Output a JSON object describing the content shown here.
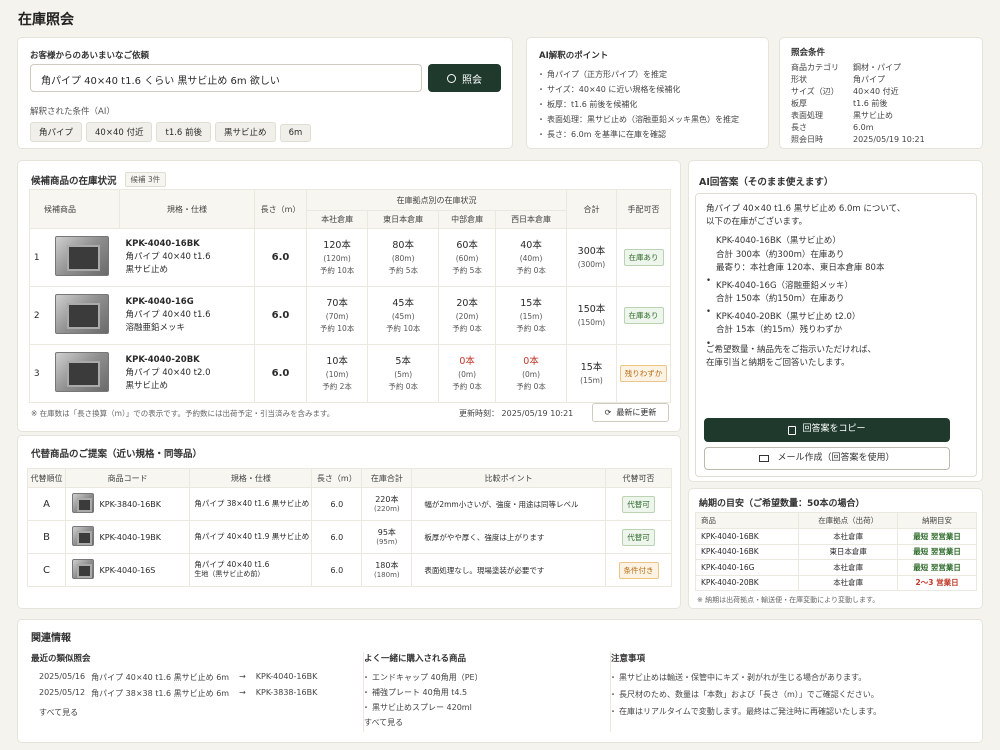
{
  "page": {
    "title": "在庫照会"
  },
  "query": {
    "label": "お客様からのあいまいなご依頼",
    "value": "角パイプ 40×40 t1.6 くらい 黒サビ止め 6m 欲しい",
    "button": "照会",
    "parsed_label": "解釈された条件（AI）",
    "chips": [
      "角パイプ",
      "40×40 付近",
      "t1.6 前後",
      "黒サビ止め",
      "6m"
    ]
  },
  "ai_points": {
    "title": "AI解釈のポイント",
    "items": [
      "角パイプ（正方形パイプ）を推定",
      "サイズ：40×40 に近い規格を候補化",
      "板厚：t1.6 前後を候補化",
      "表面処理：黒サビ止め（溶融亜鉛メッキ黒色）を推定",
      "長さ：6.0m を基準に在庫を確認"
    ]
  },
  "conditions": {
    "title": "照会条件",
    "rows": [
      [
        "商品カテゴリ",
        "鋼材・パイプ"
      ],
      [
        "形状",
        "角パイプ"
      ],
      [
        "サイズ（辺）",
        "40×40 付近"
      ],
      [
        "板厚",
        "t1.6 前後"
      ],
      [
        "表面処理",
        "黒サビ止め"
      ],
      [
        "長さ",
        "6.0m"
      ],
      [
        "照会日時",
        "2025/05/19 10:21"
      ]
    ]
  },
  "stock": {
    "title": "候補商品の在庫状況",
    "count": "候補 3件",
    "headers": {
      "item": "候補商品",
      "spec": "規格・仕様",
      "length": "長さ（m）",
      "by_loc": "在庫拠点別の在庫状況",
      "locs": [
        "本社倉庫",
        "東日本倉庫",
        "中部倉庫",
        "西日本倉庫"
      ],
      "total": "合計",
      "avail": "手配可否"
    },
    "rows": [
      {
        "no": "1",
        "code": "KPK-4040-16BK",
        "spec1": "角パイプ 40×40 t1.6",
        "spec2": "黒サビ止め",
        "length": "6.0",
        "locs": [
          [
            "120本",
            "(120m)",
            "予約 10本"
          ],
          [
            "80本",
            "(80m)",
            "予約 5本"
          ],
          [
            "60本",
            "(60m)",
            "予約 5本"
          ],
          [
            "40本",
            "(40m)",
            "予約 0本"
          ]
        ],
        "total": "300本",
        "total_m": "(300m)",
        "avail": "在庫あり"
      },
      {
        "no": "2",
        "code": "KPK-4040-16G",
        "spec1": "角パイプ 40×40 t1.6",
        "spec2": "溶融亜鉛メッキ",
        "length": "6.0",
        "locs": [
          [
            "70本",
            "(70m)",
            "予約 10本"
          ],
          [
            "45本",
            "(45m)",
            "予約 10本"
          ],
          [
            "20本",
            "(20m)",
            "予約 0本"
          ],
          [
            "15本",
            "(15m)",
            "予約 0本"
          ]
        ],
        "total": "150本",
        "total_m": "(150m)",
        "avail": "在庫あり"
      },
      {
        "no": "3",
        "code": "KPK-4040-20BK",
        "spec1": "角パイプ 40×40 t2.0",
        "spec2": "黒サビ止め",
        "length": "6.0",
        "locs": [
          [
            "10本",
            "(10m)",
            "予約 2本"
          ],
          [
            "5本",
            "(5m)",
            "予約 0本"
          ],
          [
            "0本",
            "(0m)",
            "予約 0本"
          ],
          [
            "0本",
            "(0m)",
            "予約 0本"
          ]
        ],
        "total": "15本",
        "total_m": "(15m)",
        "avail": "残りわずか"
      }
    ],
    "note": "※ 在庫数は「長さ換算（m）」での表示です。予約数には出荷予定・引当済みを含みます。",
    "updated": "更新時刻： 2025/05/19 10:21",
    "refresh": "最新に更新"
  },
  "alt": {
    "title": "代替商品のご提案（近い規格・同等品）",
    "headers": [
      "代替順位",
      "商品コード",
      "規格・仕様",
      "長さ（m）",
      "在庫合計",
      "比較ポイント",
      "代替可否"
    ],
    "rows": [
      {
        "rank": "A",
        "code": "KPK-3840-16BK",
        "spec": "角パイプ 38×40 t1.6 黒サビ止め",
        "spec2": "",
        "length": "6.0",
        "stock": "220本",
        "stock_m": "(220m)",
        "point": "幅が2mm小さいが、強度・用途は同等レベル",
        "avail": "代替可"
      },
      {
        "rank": "B",
        "code": "KPK-4040-19BK",
        "spec": "角パイプ 40×40 t1.9 黒サビ止め",
        "spec2": "",
        "length": "6.0",
        "stock": "95本",
        "stock_m": "(95m)",
        "point": "板厚がやや厚く、強度は上がります",
        "avail": "代替可"
      },
      {
        "rank": "C",
        "code": "KPK-4040-16S",
        "spec": "角パイプ 40×40 t1.6",
        "spec2": "生地（黒サビ止め前）",
        "length": "6.0",
        "stock": "180本",
        "stock_m": "(180m)",
        "point": "表面処理なし。現場塗装が必要です",
        "avail": "条件付き"
      }
    ]
  },
  "answer": {
    "title": "AI回答案（そのまま使えます）",
    "intro1": "角パイプ 40×40 t1.6 黒サビ止め 6.0m について、",
    "intro2": "以下の在庫がございます。",
    "items": [
      {
        "h": "KPK-4040-16BK（黒サビ止め）",
        "l1": "合計 300本（約300m）在庫あり",
        "l2": "最寄り：本社倉庫 120本、東日本倉庫 80本"
      },
      {
        "h": "KPK-4040-16G（溶融亜鉛メッキ）",
        "l1": "合計 150本（約150m）在庫あり",
        "l2": ""
      },
      {
        "h": "KPK-4040-20BK（黒サビ止め t2.0）",
        "l1": "合計 15本（約15m）残りわずか",
        "l2": ""
      }
    ],
    "outro1": "ご希望数量・納品先をご指示いただければ、",
    "outro2": "在庫引当と納期をご回答いたします。",
    "copy": "回答案をコピー",
    "mail": "メール作成（回答案を使用）"
  },
  "delivery": {
    "title": "納期の目安（ご希望数量：50本の場合）",
    "headers": [
      "商品",
      "在庫拠点（出荷）",
      "納期目安"
    ],
    "rows": [
      [
        "KPK-4040-16BK",
        "本社倉庫",
        "最短 翌営業日"
      ],
      [
        "KPK-4040-16BK",
        "東日本倉庫",
        "最短 翌営業日"
      ],
      [
        "KPK-4040-16G",
        "本社倉庫",
        "最短 翌営業日"
      ],
      [
        "KPK-4040-20BK",
        "本社倉庫",
        "2～3 営業日"
      ]
    ],
    "note": "※ 納期は出荷拠点・輸送便・在庫変動により変動します。"
  },
  "related": {
    "title": "関連情報",
    "recent_title": "最近の類似照会",
    "recent": [
      [
        "2025/05/16",
        "角パイプ 40×40 t1.6 黒サビ止め 6m",
        "→",
        "KPK-4040-16BK"
      ],
      [
        "2025/05/12",
        "角パイプ 38×38 t1.6 黒サビ止め 6m",
        "→",
        "KPK-3838-16BK"
      ]
    ],
    "see_all": "すべて見る",
    "bought_title": "よく一緒に購入される商品",
    "bought": [
      "エンドキャップ 40角用（PE）",
      "補強プレート 40角用 t4.5",
      "黒サビ止めスプレー 420ml"
    ],
    "notes_title": "注意事項",
    "notes": [
      "黒サビ止めは輸送・保管中にキズ・剥がれが生じる場合があります。",
      "長尺材のため、数量は「本数」および「長さ（m）」でご確認ください。",
      "在庫はリアルタイムで変動します。最終はご発注時に再確認いたします。"
    ]
  }
}
